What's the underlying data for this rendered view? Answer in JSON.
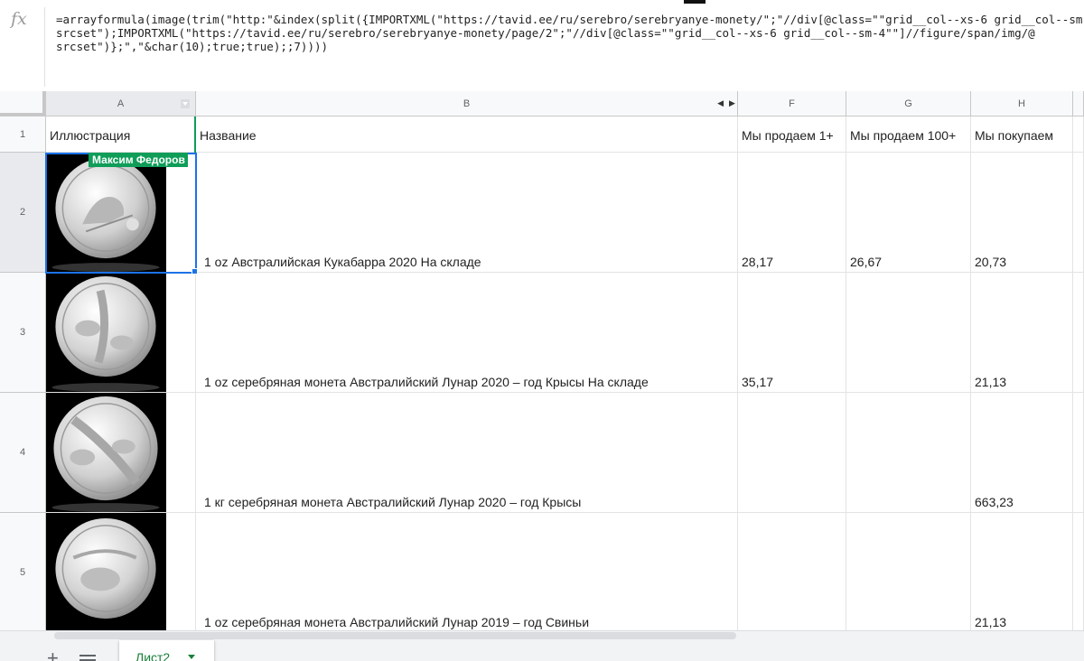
{
  "formula_bar": {
    "fx_label": "fx",
    "formula": "=arrayformula(image(trim(\"http:\"&index(split({IMPORTXML(\"https://tavid.ee/ru/serebro/serebryanye-monety/\";\"//div[@class=\"\"grid__col--xs-6 grid__col--sm-4\"\"]//figure/span/img/@\nsrcset\");IMPORTXML(\"https://tavid.ee/ru/serebro/serebryanye-monety/page/2\";\"//div[@class=\"\"grid__col--xs-6 grid__col--sm-4\"\"]//figure/span/img/@\nsrcset\")};\",\"&char(10);true;true);;7))))"
  },
  "columns": {
    "a": "A",
    "b": "B",
    "f": "F",
    "g": "G",
    "h": "H"
  },
  "header_row": {
    "num": "1",
    "a": "Иллюстрация",
    "b": "Название",
    "f": "Мы продаем 1+",
    "g": "Мы продаем 100+",
    "h": "Мы покупаем"
  },
  "rows": [
    {
      "num": "2",
      "name": "1 oz Австралийская Кукабарра 2020 На складе",
      "sell1": "28,17",
      "sell100": "26,67",
      "buy": "20,73",
      "coin": "kookaburra-coin"
    },
    {
      "num": "3",
      "name": "1 oz серебряная монета Австралийский Лунар 2020 – год Крысы На складе",
      "sell1": "35,17",
      "sell100": "",
      "buy": "21,13",
      "coin": "lunar-rat-coin"
    },
    {
      "num": "4",
      "name": "1 кг серебряная монета Австралийский Лунар 2020 – год Крысы",
      "sell1": "",
      "sell100": "",
      "buy": "663,23",
      "coin": "lunar-rat-kg-coin"
    },
    {
      "num": "5",
      "name": "1 oz серебряная монета Австралийский Лунар 2019 – год Свиньи",
      "sell1": "",
      "sell100": "",
      "buy": "21,13",
      "coin": "lunar-pig-coin"
    }
  ],
  "collaborator": {
    "name": "Максим Федоров",
    "color": "#0f9d58"
  },
  "sheet_tab": {
    "label": "Лист2"
  },
  "colors": {
    "selection": "#1a73e8",
    "active_tab": "#188038"
  }
}
